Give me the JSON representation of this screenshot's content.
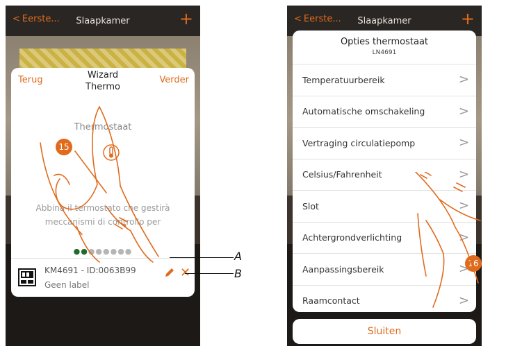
{
  "left_screen": {
    "topbar": {
      "back_label": "Eerste...",
      "title": "Slaapkamer",
      "plus": "+"
    },
    "wizard": {
      "back_label": "Terug",
      "title": "Wizard\nThermo",
      "next_label": "Verder",
      "subtitle": "Thermostaat",
      "description": "Abbina il termostato che gestirà meccanismi di controllo per",
      "device_line1": "KM4691 - ID:0063B99",
      "device_line2": "Geen label",
      "active_dots": "●●",
      "inactive_dots": "●●●●●●"
    },
    "step_badge": "15"
  },
  "callouts": {
    "a": "A",
    "b": "B"
  },
  "right_screen": {
    "topbar": {
      "back_label": "Eerste...",
      "title": "Slaapkamer",
      "plus": "+"
    },
    "sheet": {
      "title": "Opties thermostaat",
      "subtitle": "LN4691",
      "items": [
        {
          "label": "Temperatuurbereik"
        },
        {
          "label": "Automatische omschakeling"
        },
        {
          "label": "Vertraging circulatiepomp"
        },
        {
          "label": "Celsius/Fahrenheit"
        },
        {
          "label": "Slot"
        },
        {
          "label": "Achtergrondverlichting"
        },
        {
          "label": "Aanpassingsbereik"
        },
        {
          "label": "Raamcontact"
        }
      ],
      "close_label": "Sluiten"
    },
    "step_badge": "16"
  },
  "colors": {
    "accent": "#e06b1d",
    "dark_bg": "#2a2623",
    "card": "#ffffff"
  }
}
